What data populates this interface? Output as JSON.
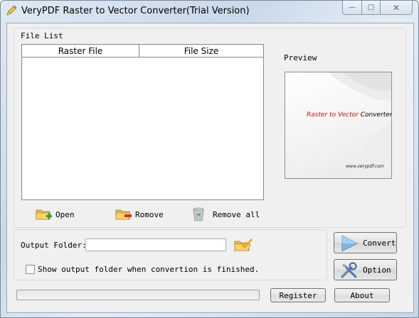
{
  "window": {
    "title": "VeryPDF Raster to Vector Converter(Trial Version)",
    "minimize_glyph": "—",
    "maximize_glyph": "□",
    "close_glyph": "✕"
  },
  "file_list": {
    "label": "File List",
    "columns": [
      "Raster File",
      "File Size"
    ],
    "rows": []
  },
  "preview": {
    "label": "Preview",
    "title_red": "Raster to Vector",
    "title_black": " Converter",
    "url": "www.verypdf.com"
  },
  "toolbar": {
    "open_label": "Open",
    "remove_label": "Romove",
    "remove_all_label": "Remove all"
  },
  "output": {
    "folder_label": "Output Folder:",
    "folder_value": "",
    "show_folder_label": "Show output folder when convertion is finished.",
    "show_folder_checked": false
  },
  "buttons": {
    "convert": "Convert",
    "option": "Option",
    "register": "Register",
    "about": "About"
  },
  "progress": {
    "value": 0
  },
  "icons": {
    "app": "pencil-icon",
    "open": "folder-add-icon",
    "remove": "folder-remove-icon",
    "remove_all": "trash-icon",
    "browse": "folder-check-icon",
    "convert": "play-icon",
    "option": "tools-icon"
  },
  "colors": {
    "preview_accent": "#cc1111",
    "convert_icon": "#5b9bd5"
  }
}
